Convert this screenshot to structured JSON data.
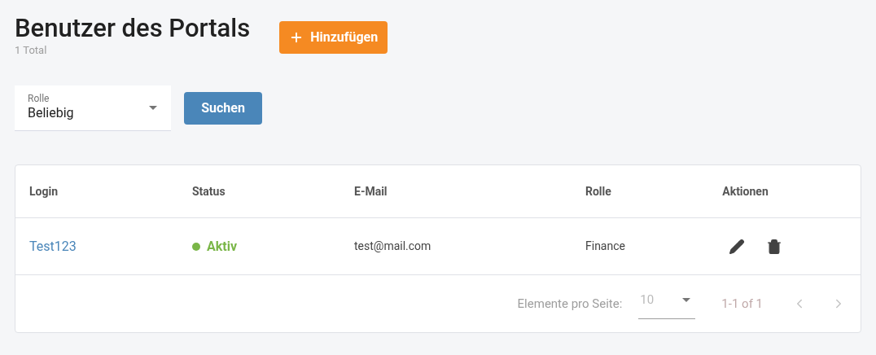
{
  "page": {
    "title": "Benutzer des Portals",
    "total": "1 Total",
    "add_button": "Hinzufügen"
  },
  "filter": {
    "label": "Rolle",
    "value": "Beliebig",
    "search_button": "Suchen"
  },
  "table": {
    "columns": [
      "Login",
      "Status",
      "E-Mail",
      "Rolle",
      "Aktionen"
    ],
    "rows": [
      {
        "login": "Test123",
        "status": "Aktiv",
        "active": true,
        "email": "test@mail.com",
        "role": "Finance"
      }
    ]
  },
  "pagination": {
    "label": "Elemente pro Seite:",
    "page_size": "10",
    "range": "1-1 of 1",
    "prev_disabled": true,
    "next_disabled": true
  }
}
